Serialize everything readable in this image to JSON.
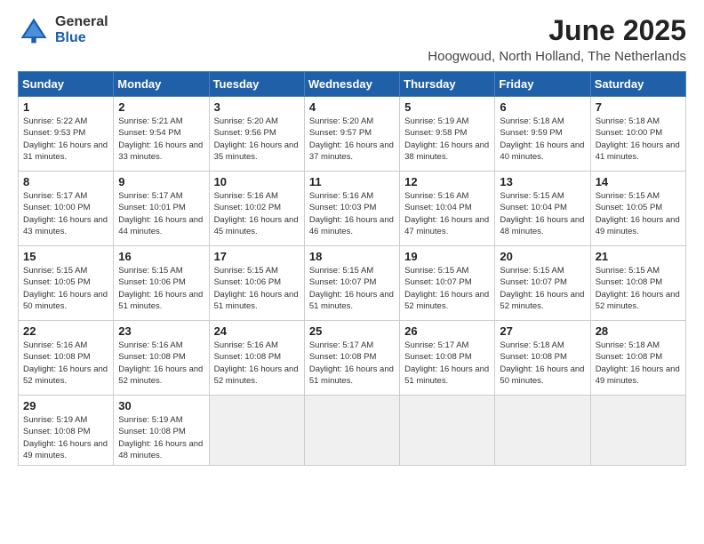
{
  "logo": {
    "general": "General",
    "blue": "Blue"
  },
  "title": "June 2025",
  "subtitle": "Hoogwoud, North Holland, The Netherlands",
  "weekdays": [
    "Sunday",
    "Monday",
    "Tuesday",
    "Wednesday",
    "Thursday",
    "Friday",
    "Saturday"
  ],
  "weeks": [
    [
      {
        "day": 1,
        "sunrise": "5:22 AM",
        "sunset": "9:53 PM",
        "daylight": "16 hours and 31 minutes."
      },
      {
        "day": 2,
        "sunrise": "5:21 AM",
        "sunset": "9:54 PM",
        "daylight": "16 hours and 33 minutes."
      },
      {
        "day": 3,
        "sunrise": "5:20 AM",
        "sunset": "9:56 PM",
        "daylight": "16 hours and 35 minutes."
      },
      {
        "day": 4,
        "sunrise": "5:20 AM",
        "sunset": "9:57 PM",
        "daylight": "16 hours and 37 minutes."
      },
      {
        "day": 5,
        "sunrise": "5:19 AM",
        "sunset": "9:58 PM",
        "daylight": "16 hours and 38 minutes."
      },
      {
        "day": 6,
        "sunrise": "5:18 AM",
        "sunset": "9:59 PM",
        "daylight": "16 hours and 40 minutes."
      },
      {
        "day": 7,
        "sunrise": "5:18 AM",
        "sunset": "10:00 PM",
        "daylight": "16 hours and 41 minutes."
      }
    ],
    [
      {
        "day": 8,
        "sunrise": "5:17 AM",
        "sunset": "10:00 PM",
        "daylight": "16 hours and 43 minutes."
      },
      {
        "day": 9,
        "sunrise": "5:17 AM",
        "sunset": "10:01 PM",
        "daylight": "16 hours and 44 minutes."
      },
      {
        "day": 10,
        "sunrise": "5:16 AM",
        "sunset": "10:02 PM",
        "daylight": "16 hours and 45 minutes."
      },
      {
        "day": 11,
        "sunrise": "5:16 AM",
        "sunset": "10:03 PM",
        "daylight": "16 hours and 46 minutes."
      },
      {
        "day": 12,
        "sunrise": "5:16 AM",
        "sunset": "10:04 PM",
        "daylight": "16 hours and 47 minutes."
      },
      {
        "day": 13,
        "sunrise": "5:15 AM",
        "sunset": "10:04 PM",
        "daylight": "16 hours and 48 minutes."
      },
      {
        "day": 14,
        "sunrise": "5:15 AM",
        "sunset": "10:05 PM",
        "daylight": "16 hours and 49 minutes."
      }
    ],
    [
      {
        "day": 15,
        "sunrise": "5:15 AM",
        "sunset": "10:05 PM",
        "daylight": "16 hours and 50 minutes."
      },
      {
        "day": 16,
        "sunrise": "5:15 AM",
        "sunset": "10:06 PM",
        "daylight": "16 hours and 51 minutes."
      },
      {
        "day": 17,
        "sunrise": "5:15 AM",
        "sunset": "10:06 PM",
        "daylight": "16 hours and 51 minutes."
      },
      {
        "day": 18,
        "sunrise": "5:15 AM",
        "sunset": "10:07 PM",
        "daylight": "16 hours and 51 minutes."
      },
      {
        "day": 19,
        "sunrise": "5:15 AM",
        "sunset": "10:07 PM",
        "daylight": "16 hours and 52 minutes."
      },
      {
        "day": 20,
        "sunrise": "5:15 AM",
        "sunset": "10:07 PM",
        "daylight": "16 hours and 52 minutes."
      },
      {
        "day": 21,
        "sunrise": "5:15 AM",
        "sunset": "10:08 PM",
        "daylight": "16 hours and 52 minutes."
      }
    ],
    [
      {
        "day": 22,
        "sunrise": "5:16 AM",
        "sunset": "10:08 PM",
        "daylight": "16 hours and 52 minutes."
      },
      {
        "day": 23,
        "sunrise": "5:16 AM",
        "sunset": "10:08 PM",
        "daylight": "16 hours and 52 minutes."
      },
      {
        "day": 24,
        "sunrise": "5:16 AM",
        "sunset": "10:08 PM",
        "daylight": "16 hours and 52 minutes."
      },
      {
        "day": 25,
        "sunrise": "5:17 AM",
        "sunset": "10:08 PM",
        "daylight": "16 hours and 51 minutes."
      },
      {
        "day": 26,
        "sunrise": "5:17 AM",
        "sunset": "10:08 PM",
        "daylight": "16 hours and 51 minutes."
      },
      {
        "day": 27,
        "sunrise": "5:18 AM",
        "sunset": "10:08 PM",
        "daylight": "16 hours and 50 minutes."
      },
      {
        "day": 28,
        "sunrise": "5:18 AM",
        "sunset": "10:08 PM",
        "daylight": "16 hours and 49 minutes."
      }
    ],
    [
      {
        "day": 29,
        "sunrise": "5:19 AM",
        "sunset": "10:08 PM",
        "daylight": "16 hours and 49 minutes."
      },
      {
        "day": 30,
        "sunrise": "5:19 AM",
        "sunset": "10:08 PM",
        "daylight": "16 hours and 48 minutes."
      },
      null,
      null,
      null,
      null,
      null
    ]
  ]
}
